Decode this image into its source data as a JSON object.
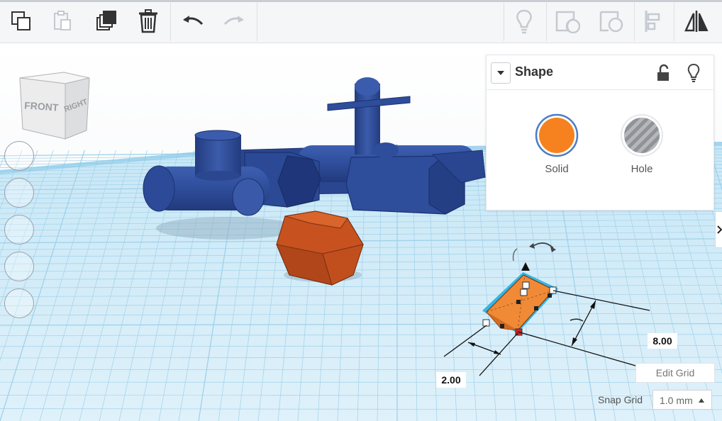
{
  "toolbar": {
    "buttons": [
      {
        "name": "copy-icon",
        "enabled": true
      },
      {
        "name": "paste-icon",
        "enabled": false
      },
      {
        "name": "duplicate-icon",
        "enabled": true
      },
      {
        "name": "trash-icon",
        "enabled": true
      },
      {
        "name": "undo-icon",
        "enabled": true
      },
      {
        "name": "redo-icon",
        "enabled": false
      },
      {
        "name": "lightbulb-icon",
        "enabled": false
      },
      {
        "name": "group-icon",
        "enabled": false
      },
      {
        "name": "ungroup-icon",
        "enabled": false
      },
      {
        "name": "align-icon",
        "enabled": false
      },
      {
        "name": "mirror-icon",
        "enabled": true
      }
    ]
  },
  "view_cube": {
    "front_label": "FRONT",
    "right_label": "RIGHT"
  },
  "shape_panel": {
    "title": "Shape",
    "solid_label": "Solid",
    "hole_label": "Hole",
    "solid_color": "#f5821f",
    "selected": "Solid"
  },
  "dimensions": {
    "length": "8.00",
    "width": "2.00"
  },
  "grid": {
    "edit_grid_label": "Edit Grid",
    "snap_grid_label": "Snap Grid",
    "snap_grid_value": "1.0 mm"
  },
  "colors": {
    "workplane": "#d4ecf7",
    "grid_line": "#9fd1ea",
    "blue_shape": "#2e4d9b",
    "orange_shape": "#c75220",
    "selection": "#35b6e6"
  }
}
